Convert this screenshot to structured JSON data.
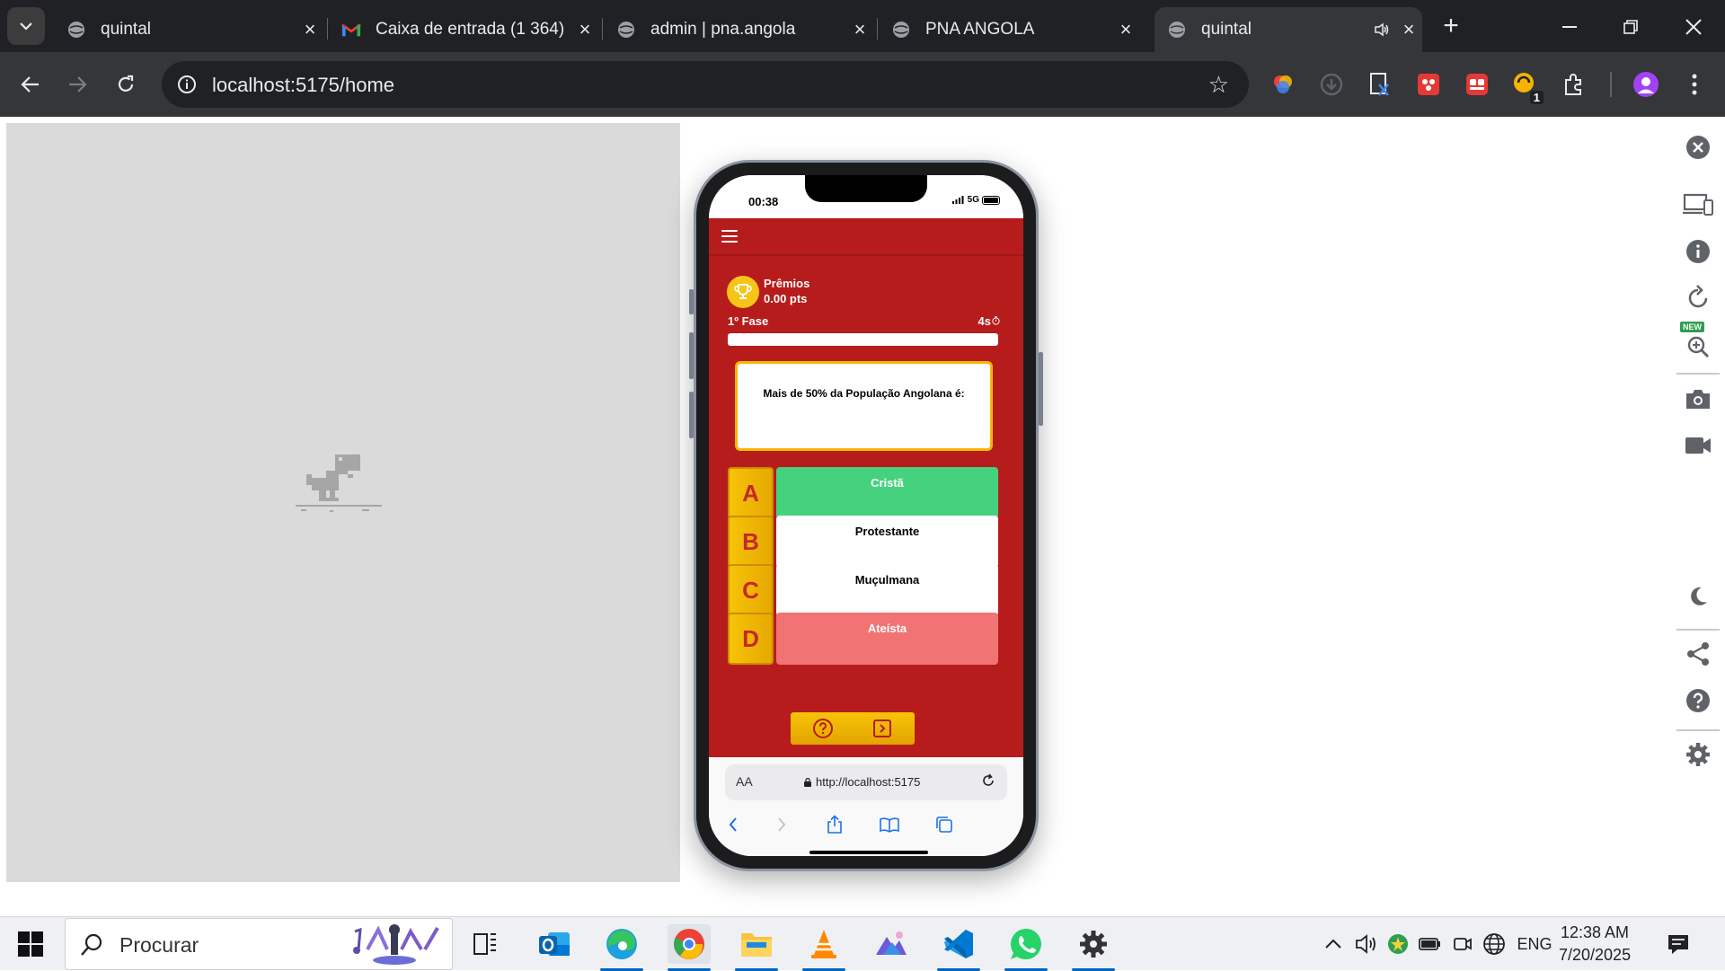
{
  "browser": {
    "tabs": [
      {
        "title": "quintal",
        "icon": "globe-icon",
        "active": false
      },
      {
        "title": "Caixa de entrada (1 364)",
        "icon": "gmail-icon",
        "active": false
      },
      {
        "title": "admin | pna.angola",
        "icon": "globe-icon",
        "active": false
      },
      {
        "title": "PNA ANGOLA",
        "icon": "globe-icon",
        "active": false
      },
      {
        "title": "quintal",
        "icon": "globe-icon",
        "active": true
      }
    ],
    "url": "localhost:5175/home",
    "extension_badge": "1"
  },
  "phone": {
    "status_time": "00:38",
    "network": "5G",
    "app": {
      "prize_label": "Prêmios",
      "prize_points": "0.00 pts",
      "phase": "1º Fase",
      "timer": "4s",
      "progress": 1.0,
      "question": "Mais de 50% da População Angolana é:",
      "answers": [
        {
          "letter": "A",
          "text": "Cristã",
          "state": "correct",
          "color": "#46d17f"
        },
        {
          "letter": "B",
          "text": "Protestante",
          "state": "neutral",
          "color": "#ffffff"
        },
        {
          "letter": "C",
          "text": "Muçulmana",
          "state": "neutral",
          "color": "#ffffff"
        },
        {
          "letter": "D",
          "text": "Ateísta",
          "state": "wrong",
          "color": "#f27373"
        }
      ],
      "theme_color": "#b71c1c",
      "accent_color": "#f5c518"
    },
    "safari": {
      "aa_label": "AA",
      "url": "http://localhost:5175"
    }
  },
  "sidebar": {
    "new_badge": "NEW"
  },
  "taskbar": {
    "search_placeholder": "Procurar",
    "language": "ENG",
    "time": "12:38 AM",
    "date": "7/20/2025"
  }
}
